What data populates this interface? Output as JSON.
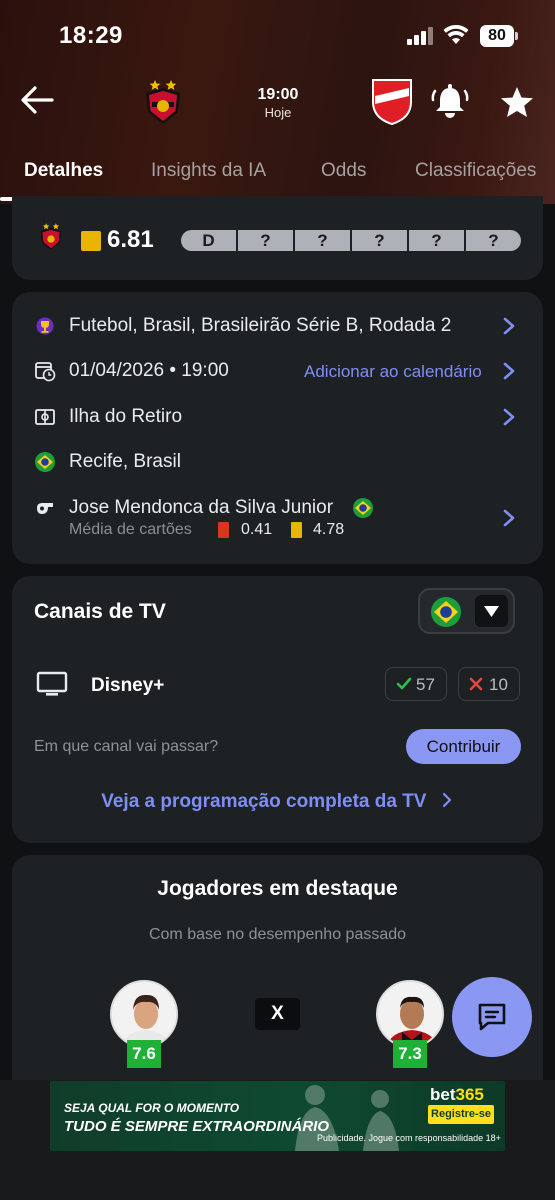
{
  "status_bar": {
    "time": "18:29",
    "battery": "80"
  },
  "match": {
    "time": "19:00",
    "day": "Hoje",
    "home_icon": "sport-recife-crest",
    "away_icon": "vila-nova-crest"
  },
  "tabs": [
    {
      "label": "Detalhes",
      "active": true
    },
    {
      "label": "Insights da IA",
      "active": false
    },
    {
      "label": "Odds",
      "active": false
    },
    {
      "label": "Classificações",
      "active": false
    }
  ],
  "form": {
    "rating": "6.81",
    "results": [
      "D",
      "?",
      "?",
      "?",
      "?",
      "?"
    ]
  },
  "info": {
    "competition": "Futebol, Brasil, Brasileirão Série B, Rodada 2",
    "datetime": "01/04/2026 • 19:00",
    "calendar_link": "Adicionar ao calendário",
    "venue": "Ilha do Retiro",
    "city": "Recife, Brasil",
    "referee": "Jose Mendonca da Silva Junior",
    "cards_label": "Média de cartões",
    "red_avg": "0.41",
    "yellow_avg": "4.78"
  },
  "tv": {
    "title": "Canais de TV",
    "channel": "Disney+",
    "upvotes": "57",
    "downvotes": "10",
    "question": "Em que canal vai passar?",
    "contribute": "Contribuir",
    "guide_link": "Veja a programação completa da TV"
  },
  "players": {
    "title": "Jogadores em destaque",
    "subtitle": "Com base no desempenho passado",
    "home_rating": "7.6",
    "away_rating": "7.3",
    "versus": "X"
  },
  "ad": {
    "line1": "SEJA QUAL FOR O MOMENTO",
    "line2": "TUDO É SEMPRE EXTRAORDINÁRIO",
    "brand_a": "bet",
    "brand_b": "365",
    "cta": "Registre-se",
    "disclaimer": "Publicidade. Jogue com responsabilidade 18+"
  },
  "colors": {
    "accent": "#8a97f3",
    "link": "#7f8ef5",
    "yellow_card": "#e9b500",
    "red_card": "#d9361f",
    "rating_green": "#1fb135"
  }
}
